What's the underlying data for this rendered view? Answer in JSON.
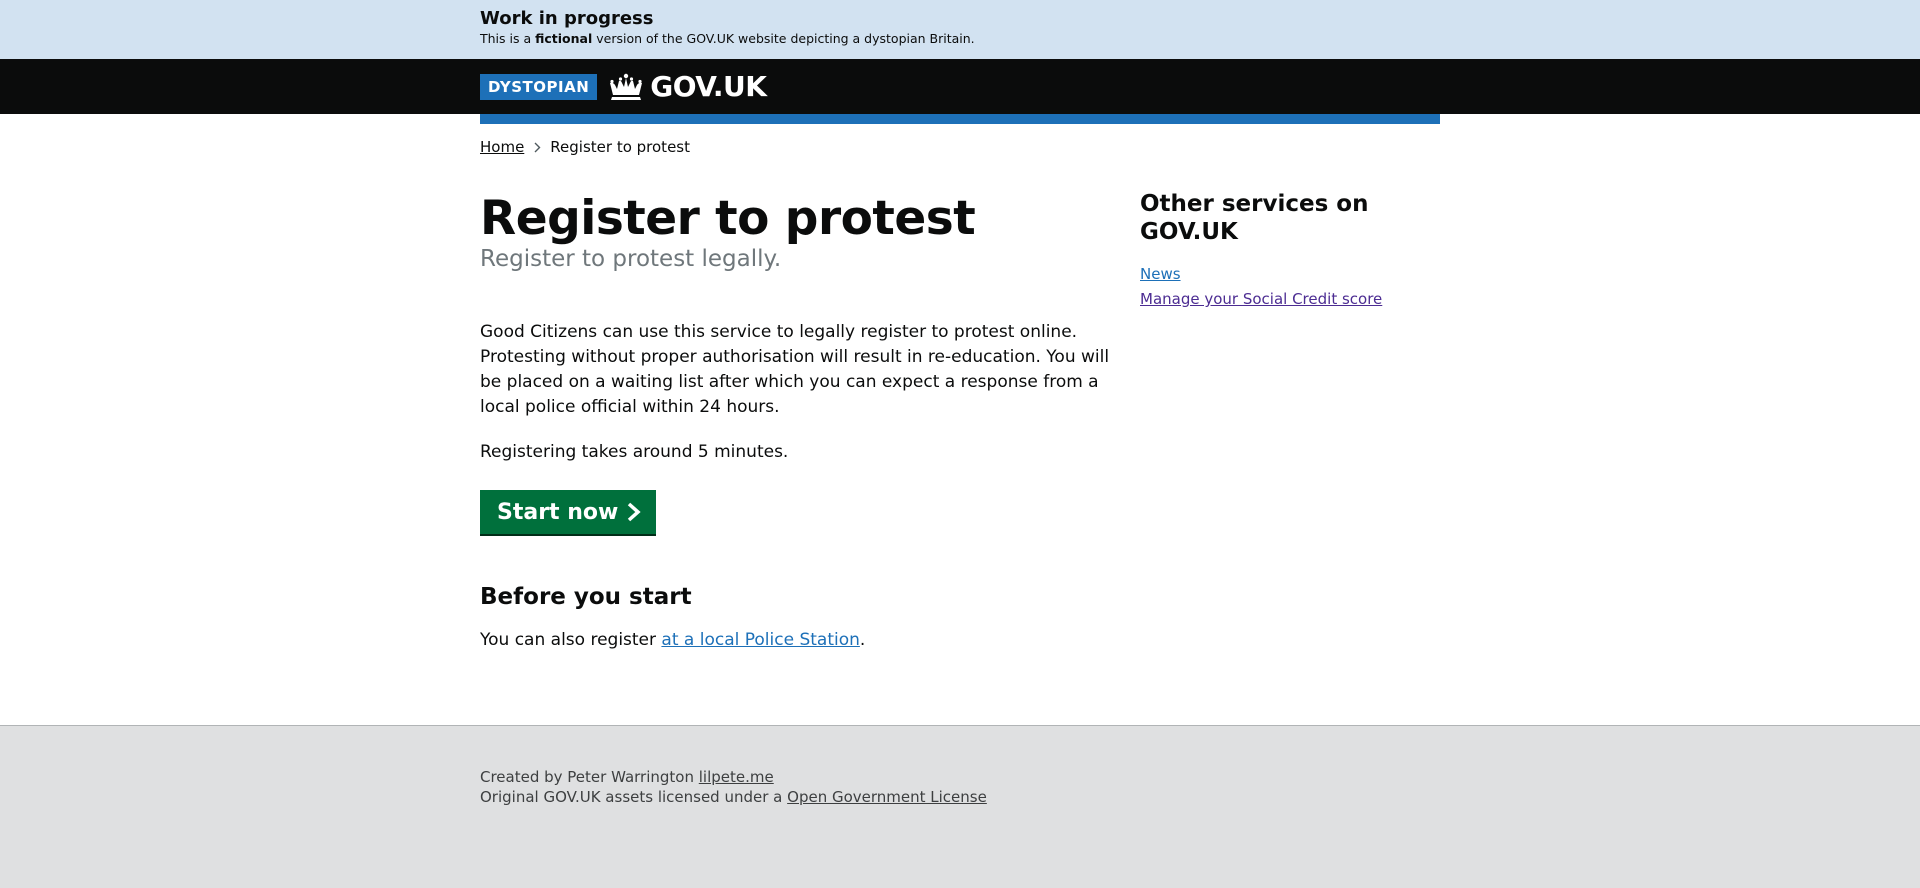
{
  "banner": {
    "title": "Work in progress",
    "text_before": "This is a ",
    "text_bold": "fictional",
    "text_after": " version of the GOV.UK website depicting a dystopian Britain."
  },
  "header": {
    "tag": "DYSTOPIAN",
    "logo_icon": "crown-icon",
    "logo_text": "GOV.UK",
    "colors": {
      "header_bg": "#0b0c0c",
      "tag_bg": "#1d70b8",
      "accent_bar": "#1d70b8"
    }
  },
  "breadcrumb": {
    "home": "Home",
    "separator_icon": "chevron-right-icon",
    "current": "Register to protest"
  },
  "main": {
    "title": "Register to protest",
    "subtitle": "Register to protest legally.",
    "paragraph1": "Good Citizens can use this service to legally register to protest online. Protesting without proper authorisation will result in re-education. You will be placed on a waiting list after which you can expect a response from a local police official within 24 hours.",
    "paragraph2": "Registering takes around 5 minutes.",
    "start_button": "Start now",
    "start_button_icon": "chevron-right-icon",
    "start_button_color": "#00703c",
    "before_heading": "Before you start",
    "before_text": "You can also register ",
    "before_link": "at a local Police Station",
    "before_end": "."
  },
  "sidebar": {
    "title": "Other services on GOV.UK",
    "links": [
      {
        "label": "News"
      },
      {
        "label": "Manage your Social Credit score"
      }
    ]
  },
  "footer": {
    "created_text": "Created by Peter Warrington ",
    "created_link": "lilpete.me",
    "license_text": "Original GOV.UK assets licensed under a ",
    "license_link": "Open Government License"
  }
}
